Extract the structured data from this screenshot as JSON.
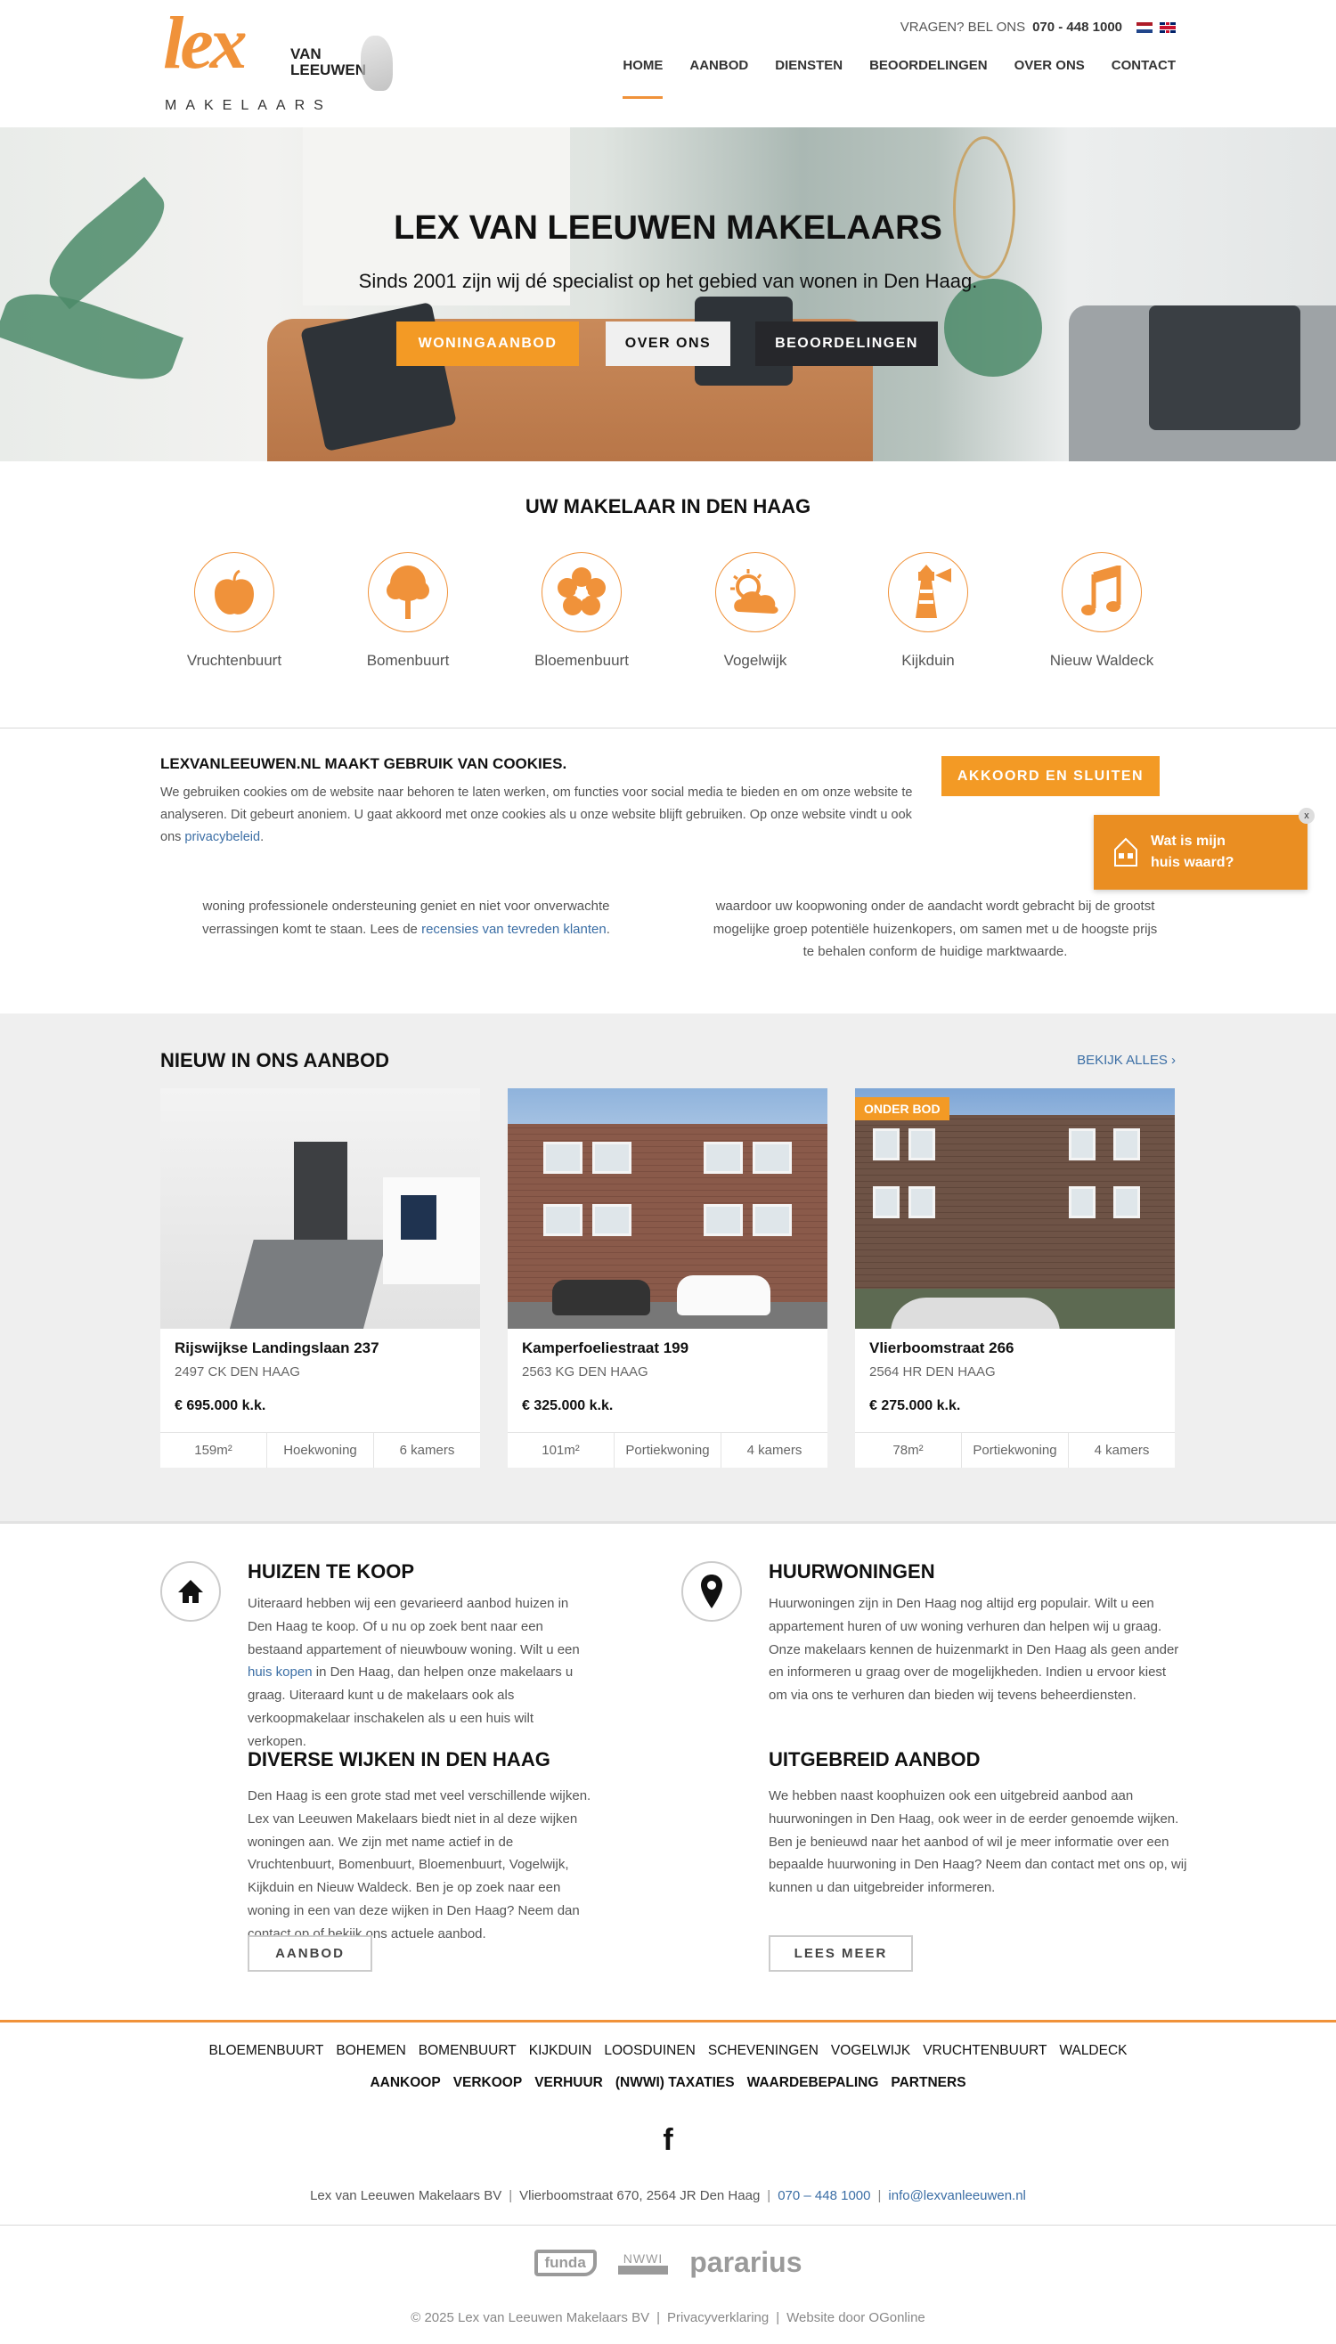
{
  "brand": {
    "logo_text": "Lex van Leeuwen Makelaars",
    "accent": "#f0923a",
    "button_orange": "#f39a25",
    "link_color": "#3b6ea5"
  },
  "header": {
    "contact_prefix": "VRAGEN? BEL ONS",
    "phone": "070 - 448 1000",
    "languages": [
      "nl-flag-icon",
      "en-flag-icon"
    ],
    "nav": [
      {
        "label": "HOME",
        "active": true
      },
      {
        "label": "AANBOD"
      },
      {
        "label": "DIENSTEN"
      },
      {
        "label": "BEOORDELINGEN"
      },
      {
        "label": "OVER ONS"
      },
      {
        "label": "CONTACT"
      }
    ]
  },
  "hero": {
    "title": "LEX VAN LEEUWEN MAKELAARS",
    "subtitle": "Sinds 2001 zijn wij dé specialist op het gebied van wonen in Den Haag.",
    "buttons": [
      "WONINGAANBOD",
      "OVER ONS",
      "BEOORDELINGEN"
    ]
  },
  "wijken": {
    "title": "UW MAKELAAR IN DEN HAAG",
    "items": [
      {
        "label": "Vruchtenbuurt",
        "icon": "apple-icon"
      },
      {
        "label": "Bomenbuurt",
        "icon": "tree-icon"
      },
      {
        "label": "Bloemenbuurt",
        "icon": "flower-icon"
      },
      {
        "label": "Vogelwijk",
        "icon": "sun-cloud-icon"
      },
      {
        "label": "Kijkduin",
        "icon": "lighthouse-icon"
      },
      {
        "label": "Nieuw Waldeck",
        "icon": "music-note-icon"
      }
    ]
  },
  "cookie": {
    "title": "LEXVANLEEUWEN.NL MAAKT GEBRUIK VAN COOKIES.",
    "text": "We gebruiken cookies om de website naar behoren te laten werken, om functies voor social media te bieden en om onze website te analyseren. Dit gebeurt anoniem. U gaat akkoord met onze cookies als u onze website blijft gebruiken. Op onze website vindt u ook ons ",
    "link": "privacybeleid",
    "after_link": ".",
    "button": "AKKOORD EN SLUITEN"
  },
  "widget": {
    "text": "Wat is mijn huis waard?",
    "close": "x"
  },
  "intro": {
    "left_lines": [
      "woning professionele ondersteuning geniet en niet voor onverwachte",
      "verrassingen komt te staan. Lees de "
    ],
    "left_link": "recensies van tevreden klanten",
    "left_after": ".",
    "right_lines": [
      "waardoor uw koopwoning onder de aandacht wordt gebracht bij de grootst",
      "mogelijke groep potentiële huizenkopers, om samen met u de hoogste prijs",
      "te behalen conform de huidige marktwaarde."
    ]
  },
  "aanbod": {
    "title": "NIEUW IN ONS AANBOD",
    "view_all": "BEKIJK ALLES ›",
    "listings": [
      {
        "street": "Rijswijkse Landingslaan 237",
        "city": "2497 CK DEN HAAG",
        "price": "€ 695.000 k.k.",
        "area": "159m²",
        "type": "Hoekwoning",
        "rooms": "6 kamers",
        "badge": ""
      },
      {
        "street": "Kamperfoeliestraat 199",
        "city": "2563 KG DEN HAAG",
        "price": "€ 325.000 k.k.",
        "area": "101m²",
        "type": "Portiekwoning",
        "rooms": "4 kamers",
        "badge": ""
      },
      {
        "street": "Vlierboomstraat 266",
        "city": "2564 HR DEN HAAG",
        "price": "€ 275.000 k.k.",
        "area": "78m²",
        "type": "Portiekwoning",
        "rooms": "4 kamers",
        "badge": "ONDER BOD"
      }
    ]
  },
  "info": {
    "koop": {
      "title": "HUIZEN TE KOOP",
      "text_before": "Uiteraard hebben wij een gevarieerd aanbod huizen in Den Haag te koop. Of u nu op zoek bent naar een bestaand appartement of nieuwbouw woning. Wilt u een ",
      "link": "huis kopen",
      "text_after": " in Den Haag, dan helpen onze makelaars u graag. Uiteraard kunt u de makelaars ook als verkoopmakelaar inschakelen als u een huis wilt verkopen."
    },
    "wijken": {
      "title": "DIVERSE WIJKEN IN DEN HAAG",
      "text": "Den Haag is een grote stad met veel verschillende wijken. Lex van Leeuwen Makelaars biedt niet in al deze wijken woningen aan. We zijn met name actief in de Vruchtenbuurt, Bomenbuurt, Bloemenbuurt, Vogelwijk, Kijkduin en Nieuw Waldeck. Ben je op zoek naar een woning in een van deze wijken in Den Haag? Neem dan contact op of bekijk ons actuele aanbod.",
      "button": "AANBOD"
    },
    "huur": {
      "title": "HUURWONINGEN",
      "text": "Huurwoningen zijn in Den Haag nog altijd erg populair. Wilt u een appartement huren of uw woning verhuren dan helpen wij u graag. Onze makelaars kennen de huizenmarkt in Den Haag als geen ander en informeren u graag over de mogelijkheden. Indien u ervoor kiest om via ons te verhuren dan bieden wij tevens beheerdiensten."
    },
    "uitgebreid": {
      "title": "UITGEBREID AANBOD",
      "text": "We hebben naast koophuizen ook een uitgebreid aanbod aan huurwoningen in Den Haag, ook weer in de eerder genoemde wijken. Ben je benieuwd naar het aanbod of wil je meer informatie over een bepaalde huurwoning in Den Haag? Neem dan contact met ons op, wij kunnen u dan uitgebreider informeren.",
      "button": "LEES MEER"
    }
  },
  "footer": {
    "wijk_links": [
      "BLOEMENBUURT",
      "BOHEMEN",
      "BOMENBUURT",
      "KIJKDUIN",
      "LOOSDUINEN",
      "SCHEVENINGEN",
      "VOGELWIJK",
      "VRUCHTENBUURT",
      "WALDECK"
    ],
    "service_links": [
      "AANKOOP",
      "VERKOOP",
      "VERHUUR",
      "(NWWI) TAXATIES",
      "WAARDEBEPALING",
      "PARTNERS"
    ],
    "social": "facebook-icon",
    "company": "Lex van Leeuwen Makelaars BV",
    "address": "Vlierboomstraat 670, 2564 JR Den Haag",
    "phone": "070 – 448 1000",
    "email": "info@lexvanleeuwen.nl",
    "partner_logos": [
      "funda",
      "NWWI",
      "pararius"
    ],
    "copyright": "© 2025 Lex van Leeuwen Makelaars BV",
    "privacy": "Privacyverklaring",
    "credit": "Website door OGonline"
  }
}
